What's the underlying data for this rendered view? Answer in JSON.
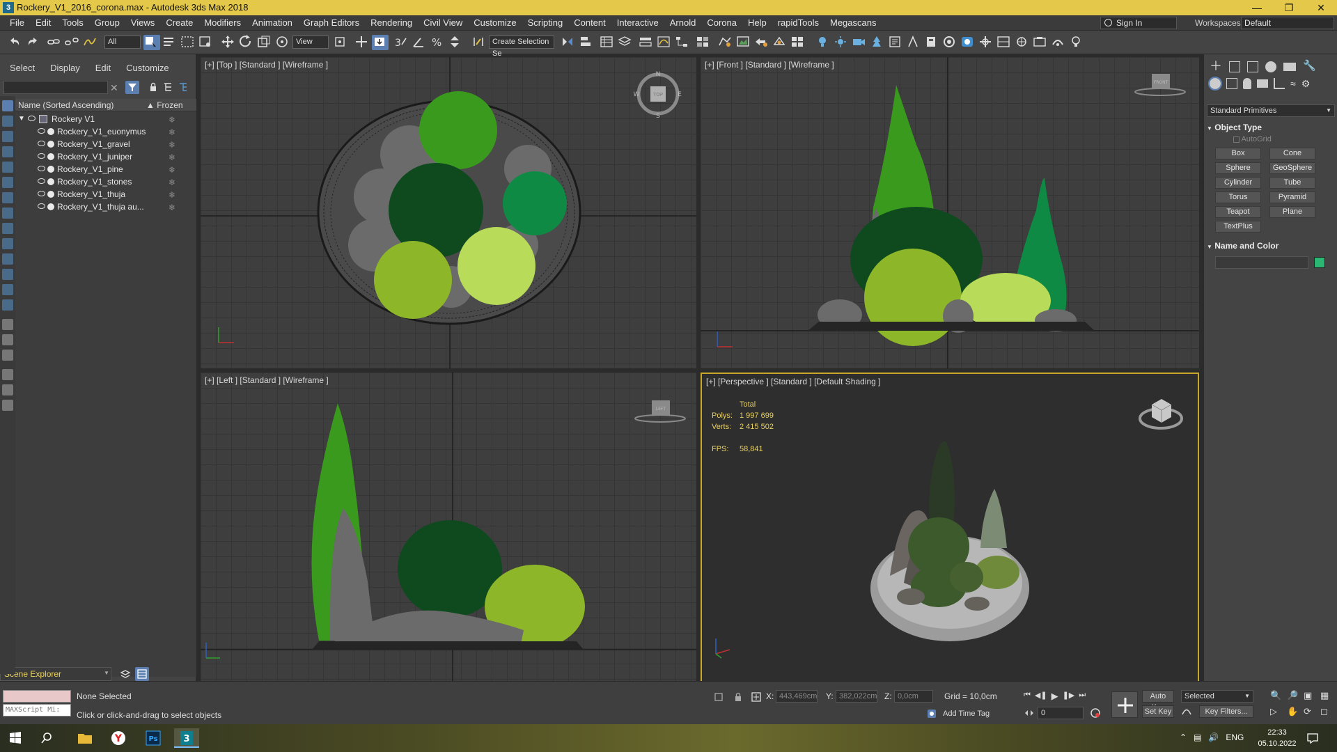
{
  "window": {
    "title": "Rockery_V1_2016_corona.max - Autodesk 3ds Max 2018",
    "app_icon": "3ds-max-icon",
    "controls": [
      "minimize-icon",
      "restore-icon",
      "close-icon"
    ]
  },
  "menubar": {
    "items": [
      "File",
      "Edit",
      "Tools",
      "Group",
      "Views",
      "Create",
      "Modifiers",
      "Animation",
      "Graph Editors",
      "Rendering",
      "Civil View",
      "Customize",
      "Scripting",
      "Content",
      "Interactive",
      "Arnold",
      "Corona",
      "Help",
      "rapidTools",
      "Megascans"
    ],
    "signin": "Sign In",
    "workspaces_label": "Workspaces:",
    "workspace_value": "Default"
  },
  "toolbar": {
    "filter_value": "All",
    "refcoord_value": "View",
    "selection_set_placeholder": "Create Selection Se"
  },
  "explorer": {
    "menu": [
      "Select",
      "Display",
      "Edit",
      "Customize"
    ],
    "col_name": "Name (Sorted Ascending)",
    "col_frozen": "▲ Frozen",
    "root": "Rockery V1",
    "children": [
      "Rockery_V1_euonymus",
      "Rockery_V1_gravel",
      "Rockery_V1_juniper",
      "Rockery_V1_pine",
      "Rockery_V1_stones",
      "Rockery_V1_thuja",
      "Rockery_V1_thuja au..."
    ],
    "footer_label": "Scene Explorer"
  },
  "viewports": {
    "top": "[+] [Top ] [Standard ] [Wireframe ]",
    "front": "[+] [Front ] [Standard ] [Wireframe ]",
    "left": "[+] [Left ] [Standard ] [Wireframe ]",
    "perspective": "[+] [Perspective ] [Standard ] [Default Shading ]",
    "stats": {
      "total_label": "Total",
      "polys_label": "Polys:",
      "polys_value": "1 997 699",
      "verts_label": "Verts:",
      "verts_value": "2 415 502",
      "fps_label": "FPS:",
      "fps_value": "58,841"
    },
    "compass_top": {
      "n": "N",
      "s": "S",
      "e": "E",
      "w": "W",
      "cube": "TOP"
    },
    "cube_front": "FRONT",
    "cube_left": "LEFT"
  },
  "cmdpanel": {
    "dropdown": "Standard Primitives",
    "rollout_object_type": "Object Type",
    "autogrid": "AutoGrid",
    "buttons": [
      "Box",
      "Cone",
      "Sphere",
      "GeoSphere",
      "Cylinder",
      "Tube",
      "Torus",
      "Pyramid",
      "Teapot",
      "Plane",
      "TextPlus"
    ],
    "rollout_name_color": "Name and Color",
    "swatch_color": "#2bb673"
  },
  "statusbar": {
    "maxscript_placeholder": "MAXScript Mi:",
    "none_selected": "None Selected",
    "prompt": "Click or click-and-drag to select objects",
    "x_label": "X:",
    "x_value": "443,469cm",
    "y_label": "Y:",
    "y_value": "382,022cm",
    "z_label": "Z:",
    "z_value": "0,0cm",
    "grid": "Grid = 10,0cm",
    "add_time_tag": "Add Time Tag",
    "auto_key": "Auto Key",
    "set_key": "Set Key",
    "selected_value": "Selected",
    "key_filters": "Key Filters...",
    "frame_value": "0"
  },
  "taskbar": {
    "time": "22:33",
    "date": "05.10.2022",
    "lang": "ENG"
  },
  "colors": {
    "accent": "#c9a72b",
    "title_bar": "#e3c84a",
    "plant_dark": "#0f4a1f",
    "plant_mid": "#3a9a1e",
    "plant_light": "#b8dc59",
    "plant_lime": "#8db628",
    "plant_teal": "#0f8a44",
    "stone": "#6b6b6b"
  }
}
